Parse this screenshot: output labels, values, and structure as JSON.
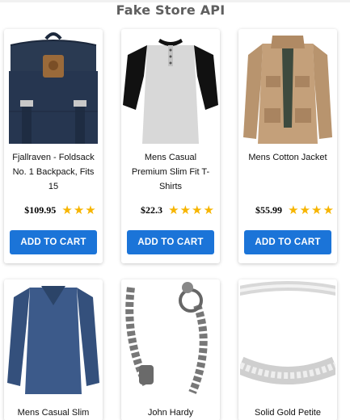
{
  "header": {
    "title": "Fake Store API"
  },
  "products": [
    {
      "name": "Fjallraven - Foldsack No. 1 Backpack, Fits 15",
      "price": "$109.95",
      "rating_stars_visible": 3,
      "button_label": "ADD TO CART",
      "image_icon": "backpack"
    },
    {
      "name": "Mens Casual Premium Slim Fit T-Shirts",
      "price": "$22.3",
      "rating_stars_visible": 4,
      "button_label": "ADD TO CART",
      "image_icon": "raglan-shirt"
    },
    {
      "name": "Mens Cotton Jacket",
      "price": "$55.99",
      "rating_stars_visible": 4,
      "button_label": "ADD TO CART",
      "image_icon": "jacket"
    },
    {
      "name": "Mens Casual Slim",
      "image_icon": "long-sleeve-shirt"
    },
    {
      "name": "John Hardy",
      "image_icon": "chain-bracelet"
    },
    {
      "name": "Solid Gold Petite",
      "image_icon": "ring"
    }
  ],
  "colors": {
    "button": "#1b74d8",
    "star": "#f7b500",
    "title": "#5f5f5f"
  }
}
